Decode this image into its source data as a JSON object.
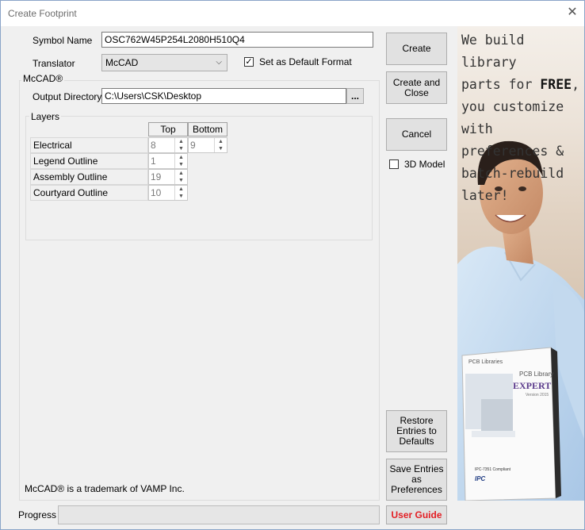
{
  "window": {
    "title": "Create Footprint",
    "close_glyph": "✕"
  },
  "form": {
    "symbol_name_label": "Symbol Name",
    "symbol_name_value": "OSC762W45P254L2080H510Q4",
    "translator_label": "Translator",
    "translator_value": "McCAD",
    "default_format_label": "Set as Default Format",
    "default_format_checked": true,
    "group_title": "McCAD®",
    "output_dir_label": "Output Directory",
    "output_dir_value": "C:\\Users\\CSK\\Desktop",
    "browse_label": "...",
    "layers_title": "Layers",
    "layers_columns": [
      "Top",
      "Bottom"
    ],
    "layers": [
      {
        "name": "Electrical",
        "top": "8",
        "bottom": "9"
      },
      {
        "name": "Legend Outline",
        "top": "1"
      },
      {
        "name": "Assembly Outline",
        "top": "19"
      },
      {
        "name": "Courtyard Outline",
        "top": "10"
      }
    ],
    "trademark": "McCAD® is a trademark of VAMP Inc.",
    "progress_label": "Progress",
    "progress_value": 0
  },
  "buttons": {
    "create": "Create",
    "create_close": "Create and Close",
    "cancel": "Cancel",
    "model3d_label": "3D Model",
    "model3d_checked": false,
    "restore": "Restore Entries to Defaults",
    "save_prefs": "Save Entries as Preferences",
    "user_guide": "User Guide",
    "user_guide_color": "#e31e24"
  },
  "ad": {
    "line1": "We build library",
    "line2a": "parts for ",
    "line2b": "FREE",
    "line2c": ",",
    "line3": "you customize",
    "line4": "with preferences &",
    "line5": "batch-rebuild later!",
    "box_brand": "PCB Libraries",
    "box_title1": "PCB Library",
    "box_title2": "EXPERT",
    "box_version": "Version 2015",
    "box_compliant": "IPC-7351 Compliant",
    "box_logo": "IPC"
  }
}
